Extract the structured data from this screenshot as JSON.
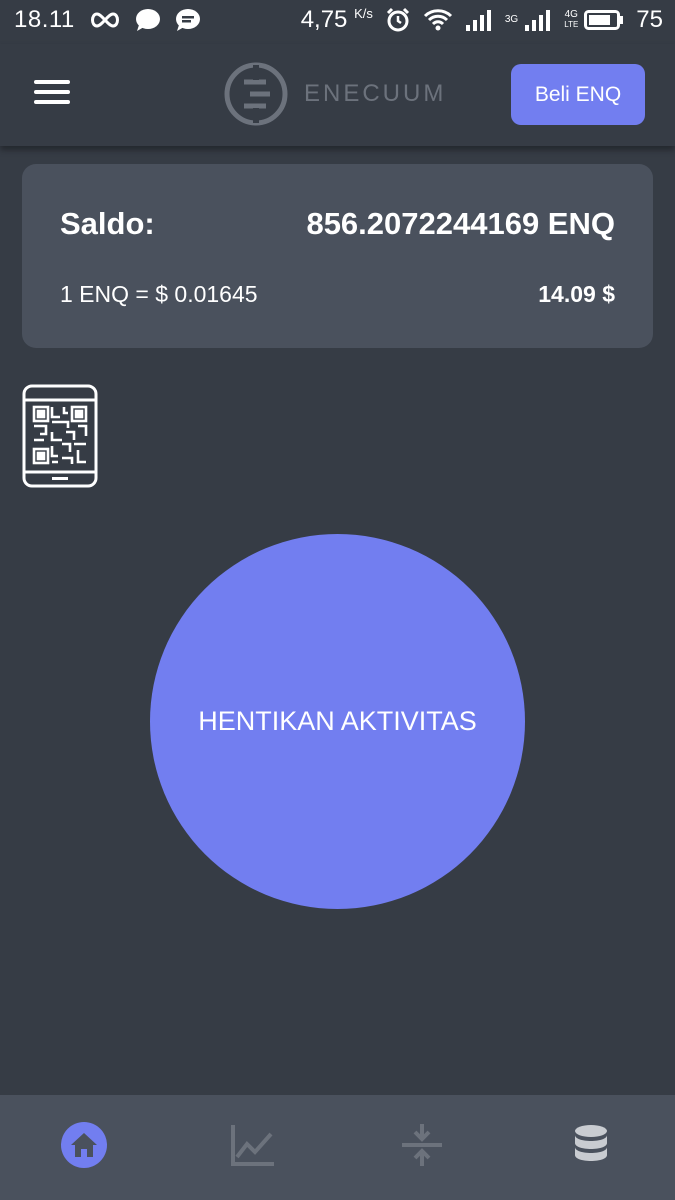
{
  "status_bar": {
    "time": "18.11",
    "speed_value": "4,75",
    "speed_unit": "K/s",
    "network_3g": "3G",
    "network_4g": "4G",
    "network_lte": "LTE",
    "battery_level": "75"
  },
  "header": {
    "logo_text": "ENECUUM",
    "buy_label": "Beli ENQ"
  },
  "balance": {
    "label": "Saldo:",
    "value": "856.2072244169 ENQ",
    "rate": "1 ENQ = $ 0.01645",
    "usd_value": "14.09 $"
  },
  "main": {
    "action_label": "HENTIKAN AKTIVITAS"
  },
  "bottom_nav": {
    "items": [
      "home-icon",
      "chart-icon",
      "transfer-icon",
      "database-icon"
    ],
    "active": "home-icon"
  },
  "colors": {
    "background": "#363c45",
    "card": "#4a515d",
    "accent": "#727ef0",
    "muted": "#6c727c"
  }
}
